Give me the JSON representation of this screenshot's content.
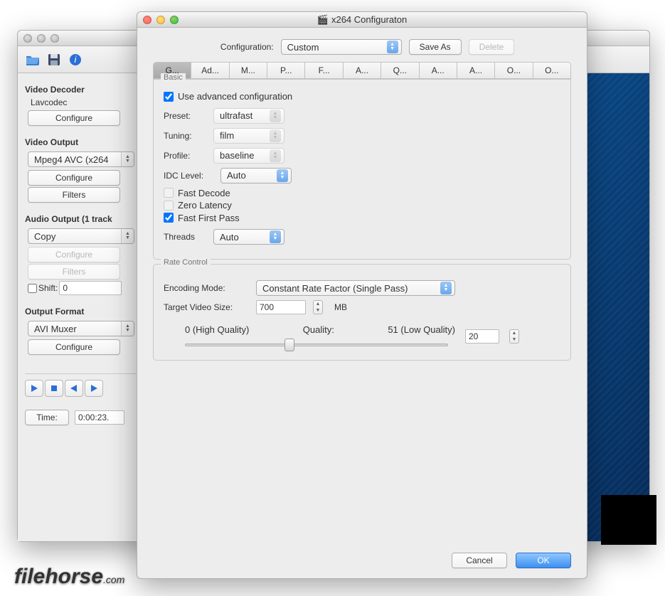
{
  "backWindow": {
    "sidebar": {
      "videoDecoder": {
        "heading": "Video Decoder",
        "codec": "Lavcodec",
        "configure": "Configure"
      },
      "videoOutput": {
        "heading": "Video Output",
        "codec": "Mpeg4 AVC (x264",
        "configure": "Configure",
        "filters": "Filters"
      },
      "audioOutput": {
        "heading": "Audio Output (1 track",
        "codec": "Copy",
        "configure": "Configure",
        "filters": "Filters",
        "shiftLabel": "Shift:",
        "shiftValue": "0"
      },
      "outputFormat": {
        "heading": "Output Format",
        "muxer": "AVI Muxer",
        "configure": "Configure"
      }
    },
    "timeLabel": "Time:",
    "timeValue": "0:00:23."
  },
  "dialog": {
    "title": "x264 Configuraton",
    "configLabel": "Configuration:",
    "configValue": "Custom",
    "saveAs": "Save As",
    "delete": "Delete",
    "tabs": [
      "G...",
      "Ad...",
      "M...",
      "P...",
      "F...",
      "A...",
      "Q...",
      "A...",
      "A...",
      "O...",
      "O..."
    ],
    "basic": {
      "legend": "Basic",
      "useAdvanced": "Use advanced configuration",
      "presetLabel": "Preset:",
      "presetValue": "ultrafast",
      "tuningLabel": "Tuning:",
      "tuningValue": "film",
      "profileLabel": "Profile:",
      "profileValue": "baseline",
      "idcLabel": "IDC Level:",
      "idcValue": "Auto",
      "fastDecode": "Fast Decode",
      "zeroLatency": "Zero Latency",
      "fastFirstPass": "Fast First Pass",
      "threadsLabel": "Threads",
      "threadsValue": "Auto"
    },
    "rate": {
      "legend": "Rate Control",
      "encModeLabel": "Encoding Mode:",
      "encModeValue": "Constant Rate Factor (Single Pass)",
      "targetLabel": "Target Video Size:",
      "targetValue": "700",
      "targetUnit": "MB",
      "sliderLow": "0 (High Quality)",
      "sliderMid": "Quality:",
      "sliderHigh": "51 (Low Quality)",
      "sliderValue": "20"
    },
    "cancel": "Cancel",
    "ok": "OK"
  },
  "watermarkText": "filehorse",
  "watermarkSuffix": ".com"
}
